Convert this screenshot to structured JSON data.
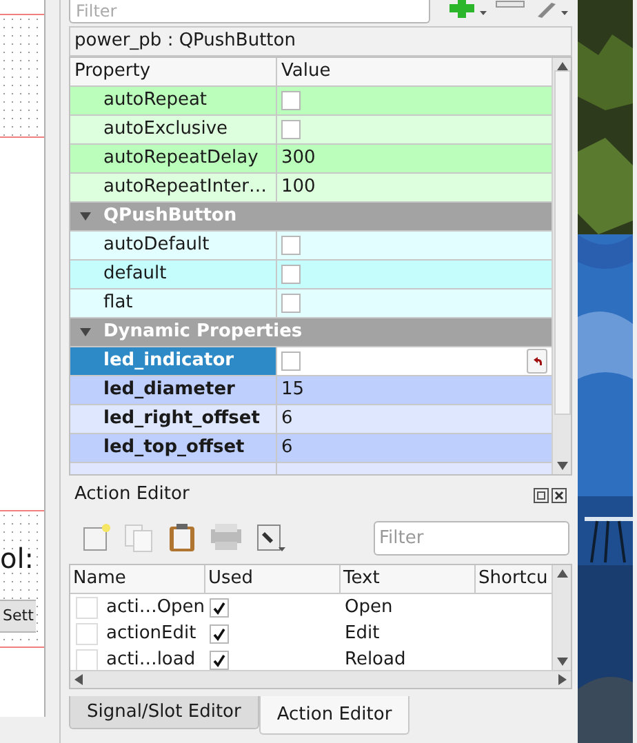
{
  "canvas": {
    "label": "ol:",
    "button": "Sett"
  },
  "property_editor": {
    "filter": {
      "placeholder": "Filter"
    },
    "object": "power_pb : QPushButton",
    "columns": [
      "Property",
      "Value"
    ],
    "sections": [
      {
        "kind": "class",
        "color": "#bbfebb",
        "rows": [
          {
            "name": "autoRepeat",
            "kind": "checkbox",
            "checked": false,
            "selected": false
          },
          {
            "name": "autoExclusive",
            "kind": "checkbox",
            "checked": false,
            "selected": false
          },
          {
            "name": "autoRepeatDelay",
            "kind": "text",
            "value": "300",
            "selected": false
          },
          {
            "name": "autoRepeatInter…",
            "kind": "text",
            "value": "100",
            "selected": false
          }
        ]
      },
      {
        "kind": "class",
        "title": "QPushButton",
        "expanded": true,
        "color": "#c5fdfd",
        "rows": [
          {
            "name": "autoDefault",
            "kind": "checkbox",
            "checked": false,
            "selected": false
          },
          {
            "name": "default",
            "kind": "checkbox",
            "checked": false,
            "selected": false
          },
          {
            "name": "flat",
            "kind": "checkbox",
            "checked": false,
            "selected": false
          }
        ]
      },
      {
        "kind": "dynamic",
        "title": "Dynamic Properties",
        "expanded": true,
        "color": "#bfcffd",
        "rows": [
          {
            "name": "led_indicator",
            "kind": "checkbox",
            "checked": false,
            "selected": true
          },
          {
            "name": "led_diameter",
            "kind": "text",
            "value": "15",
            "selected": false
          },
          {
            "name": "led_right_offset",
            "kind": "text",
            "value": "6",
            "selected": false
          },
          {
            "name": "led_top_offset",
            "kind": "text",
            "value": "6",
            "selected": false
          }
        ]
      }
    ]
  },
  "action_editor": {
    "title": "Action Editor",
    "filter": {
      "placeholder": "Filter"
    },
    "columns": [
      "Name",
      "Used",
      "Text",
      "Shortcu"
    ],
    "rows": [
      {
        "name": "acti…Open",
        "used": true,
        "text": "Open"
      },
      {
        "name": "actionEdit",
        "used": true,
        "text": "Edit"
      },
      {
        "name": "acti…load",
        "used": true,
        "text": "Reload"
      }
    ]
  },
  "tabs": [
    {
      "label": "Signal/Slot Editor",
      "selected": false
    },
    {
      "label": "Action Editor",
      "selected": true
    }
  ]
}
